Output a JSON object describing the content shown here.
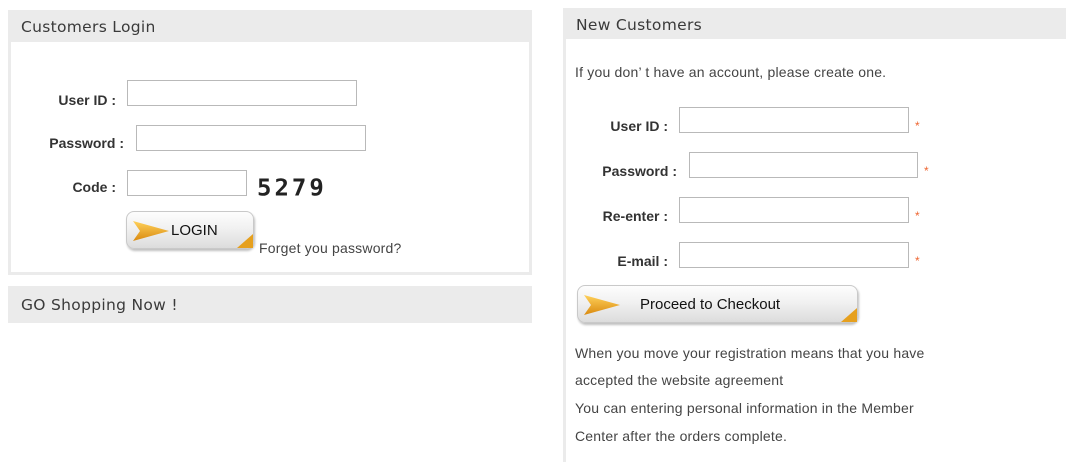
{
  "login": {
    "title": "Customers Login",
    "user_id_label": "User ID :",
    "password_label": "Password :",
    "code_label": "Code :",
    "user_id_value": "",
    "password_value": "",
    "code_value": "",
    "captcha": "5279",
    "login_button": "LOGIN",
    "forgot_link": "Forget you password?"
  },
  "shopping": {
    "title": "GO Shopping Now !"
  },
  "register": {
    "title": "New Customers",
    "intro": "If you don’ t have an account, please create one.",
    "user_id_label": "User ID :",
    "password_label": "Password :",
    "reenter_label": "Re-enter :",
    "email_label": "E-mail :",
    "required_mark": "*",
    "checkout_button": "Proceed to Checkout",
    "note_line1": "When you move your registration means that you have",
    "note_line2": "accepted the website agreement",
    "note_line3": "You can entering personal information in the Member",
    "note_line4": "Center after the orders complete."
  },
  "colors": {
    "header_bg": "#ebebeb",
    "required": "#ee6633",
    "arrow": "#e6a01e"
  },
  "icons": {
    "button_arrow": "orange-arrow-icon",
    "button_corner": "orange-corner-icon"
  }
}
